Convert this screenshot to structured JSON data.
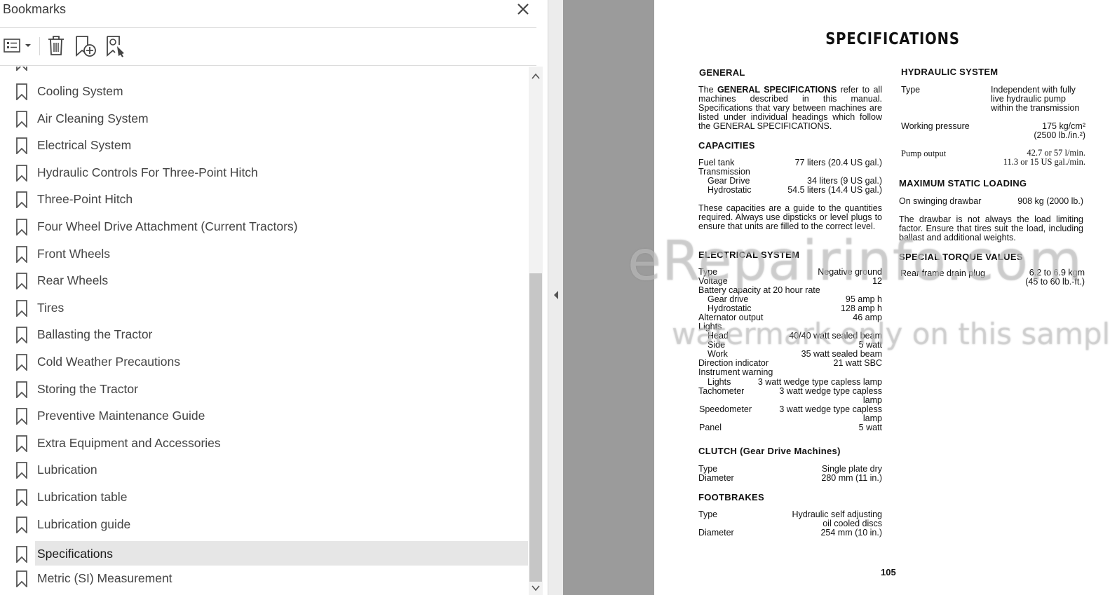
{
  "bookmarks_panel": {
    "title": "Bookmarks",
    "items": [
      {
        "label": "Cooling System"
      },
      {
        "label": "Air Cleaning System"
      },
      {
        "label": "Electrical System"
      },
      {
        "label": "Hydraulic Controls For Three-Point Hitch"
      },
      {
        "label": "Three-Point Hitch"
      },
      {
        "label": "Four Wheel Drive Attachment (Current Tractors)"
      },
      {
        "label": "Front Wheels"
      },
      {
        "label": "Rear Wheels"
      },
      {
        "label": "Tires"
      },
      {
        "label": "Ballasting the Tractor"
      },
      {
        "label": "Cold Weather Precautions"
      },
      {
        "label": "Storing the Tractor"
      },
      {
        "label": "Preventive Maintenance Guide"
      },
      {
        "label": "Extra Equipment and Accessories"
      },
      {
        "label": "Lubrication"
      },
      {
        "label": "Lubrication table"
      },
      {
        "label": "Lubrication guide"
      },
      {
        "label": "Specifications",
        "selected": true
      },
      {
        "label": "Metric (SI) Measurement"
      }
    ],
    "toolbar_icons": [
      "options-menu-icon",
      "delete-bookmark-icon",
      "new-bookmark-icon",
      "find-bookmark-icon"
    ]
  },
  "page": {
    "title": "SPECIFICATIONS",
    "page_number": "105",
    "general": {
      "heading": "GENERAL",
      "p1": "The",
      "p_bold": "GENERAL SPECIFICATIONS",
      "p2": "refer to all machines described in this manual. Specifications that vary between machines are listed under individual headings which follow the GENERAL SPECIFICATIONS."
    },
    "capacities": {
      "heading": "CAPACITIES",
      "fuel_label": "Fuel tank",
      "fuel_value": "77 liters (20.4 US gal.)",
      "trans_label": "Transmission",
      "gear_label": "Gear Drive",
      "gear_value": "34 liters (9 US gal.)",
      "hydro_label": "Hydrostatic",
      "hydro_value": "54.5 liters (14.4 US gal.)",
      "note": "These capacities are a guide to the quantities required. Always use dipsticks or level plugs to ensure that units are filled to the correct level."
    },
    "electrical": {
      "heading": "ELECTRICAL SYSTEM",
      "type_label": "Type",
      "type_value": "Negative ground",
      "voltage_label": "Voltage",
      "voltage_value": "12",
      "battery_label": "Battery capacity at 20 hour rate",
      "bgear_label": "Gear drive",
      "bgear_value": "95 amp h",
      "bhydro_label": "Hydrostatic",
      "bhydro_value": "128 amp h",
      "alt_label": "Alternator output",
      "alt_value": "46 amp",
      "lights_label": "Lights",
      "head_label": "Head",
      "head_value": "40/40 watt sealed beam",
      "side_label": "Side",
      "side_value": "5 watt",
      "work_label": "Work",
      "work_value": "35 watt sealed beam",
      "dir_label": "Direction indicator",
      "dir_value": "21 watt SBC",
      "instr_label": "Instrument warning",
      "ilights_label": "Lights",
      "ilights_value": "3 watt wedge type capless lamp",
      "tacho_label": "Tachometer",
      "tacho_value_1": "3 watt wedge type capless",
      "tacho_value_2": "lamp",
      "speedo_label": "Speedometer",
      "speedo_value_1": "3 watt wedge type capless",
      "speedo_value_2": "lamp",
      "panel_label": "Panel",
      "panel_value": "5 watt"
    },
    "clutch": {
      "heading": "CLUTCH  (Gear Drive Machines)",
      "type_label": "Type",
      "type_value": "Single plate dry",
      "dia_label": "Diameter",
      "dia_value": "280 mm (11 in.)"
    },
    "footbrakes": {
      "heading": "FOOTBRAKES",
      "type_label": "Type",
      "type_value_1": "Hydraulic self adjusting",
      "type_value_2": "oil cooled discs",
      "dia_label": "Diameter",
      "dia_value": "254 mm (10 in.)"
    },
    "hydraulic": {
      "heading": "HYDRAULIC SYSTEM",
      "type_label": "Type",
      "type_value_1": "Independent with fully",
      "type_value_2": "live hydraulic pump",
      "type_value_3": "within the transmission",
      "wp_label": "Working pressure",
      "wp_value_1": "175 kg/cm²",
      "wp_value_2": "(2500 lb./in.²)",
      "po_label": "Pump output",
      "po_value_1": "42.7 or 57 l/min.",
      "po_value_2": "11.3 or 15 US gal./min."
    },
    "static_loading": {
      "heading": "MAXIMUM STATIC LOADING",
      "label": "On swinging drawbar",
      "value": "908 kg (2000 lb.)",
      "note": "The drawbar is not always the load limiting factor. Ensure that tires suit the load, including ballast and additional weights."
    },
    "torque": {
      "heading": "SPECIAL TORQUE VALUES",
      "label": "Rear frame drain plug",
      "value_1": "6.2 to 6.9 kgm",
      "value_2": "(45 to 60 lb.-ft.)"
    }
  },
  "watermark": {
    "line1": "eRepairinfo.com",
    "line2": "watermark only on this sample"
  }
}
